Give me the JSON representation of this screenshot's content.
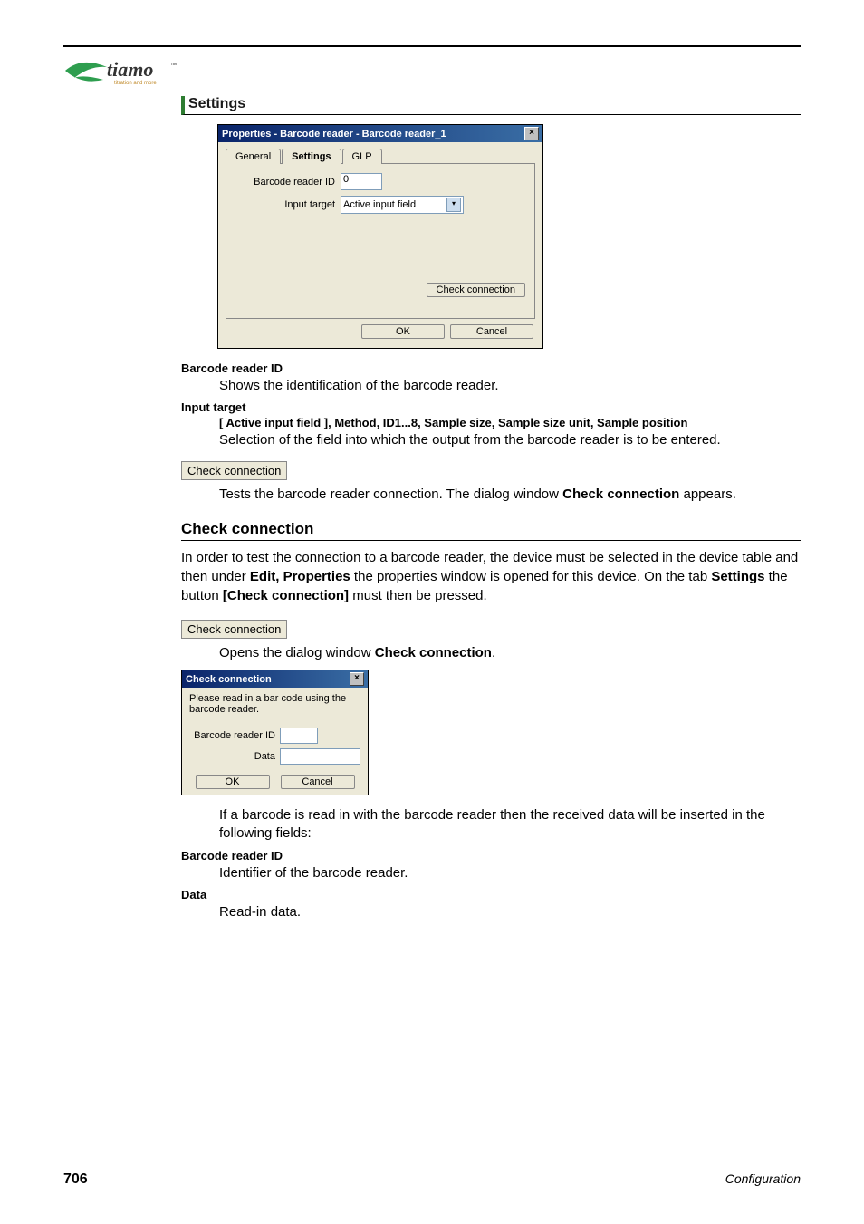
{
  "section1_title": "Settings",
  "dialog1": {
    "title": "Properties - Barcode reader - Barcode reader_1",
    "tabs": {
      "general": "General",
      "settings": "Settings",
      "glp": "GLP"
    },
    "label_id": "Barcode reader ID",
    "value_id": "0",
    "label_target": "Input target",
    "value_target": "Active input field",
    "btn_check": "Check connection",
    "btn_ok": "OK",
    "btn_cancel": "Cancel"
  },
  "def1_term": "Barcode reader ID",
  "def1_text": "Shows the identification of the barcode reader.",
  "def2_term": "Input target",
  "def2_bold": "[ Active input field ], Method, ID1...8, Sample size, Sample size unit, Sample position",
  "def2_text": "Selection of the field into which the output from the barcode reader is to be entered.",
  "inline_btn1": "Check connection",
  "def3_text_a": "Tests the barcode reader connection. The dialog window ",
  "def3_text_b": "Check connection",
  "def3_text_c": " appears.",
  "section2_title": "Check connection",
  "para2_a": "In order to test the connection to a barcode reader, the device must be selected in the device table and then under ",
  "para2_b": "Edit, Properties",
  "para2_c": " the properties window is opened for this device. On the tab ",
  "para2_d": "Settings",
  "para2_e": " the button ",
  "para2_f": "[Check connection]",
  "para2_g": " must then be pressed.",
  "inline_btn2": "Check connection",
  "def4_text_a": "Opens the dialog window ",
  "def4_text_b": "Check connection",
  "def4_text_c": ".",
  "dialog2": {
    "title": "Check connection",
    "instruction": "Please read in a bar code using the barcode reader.",
    "label_id": "Barcode reader ID",
    "label_data": "Data",
    "btn_ok": "OK",
    "btn_cancel": "Cancel"
  },
  "def5_text": "If a barcode is read in with the barcode reader then the received data will be inserted in the following fields:",
  "def6_term": "Barcode reader ID",
  "def6_text": "Identifier of the barcode reader.",
  "def7_term": "Data",
  "def7_text": "Read-in data.",
  "footer": {
    "page": "706",
    "right": "Configuration"
  }
}
